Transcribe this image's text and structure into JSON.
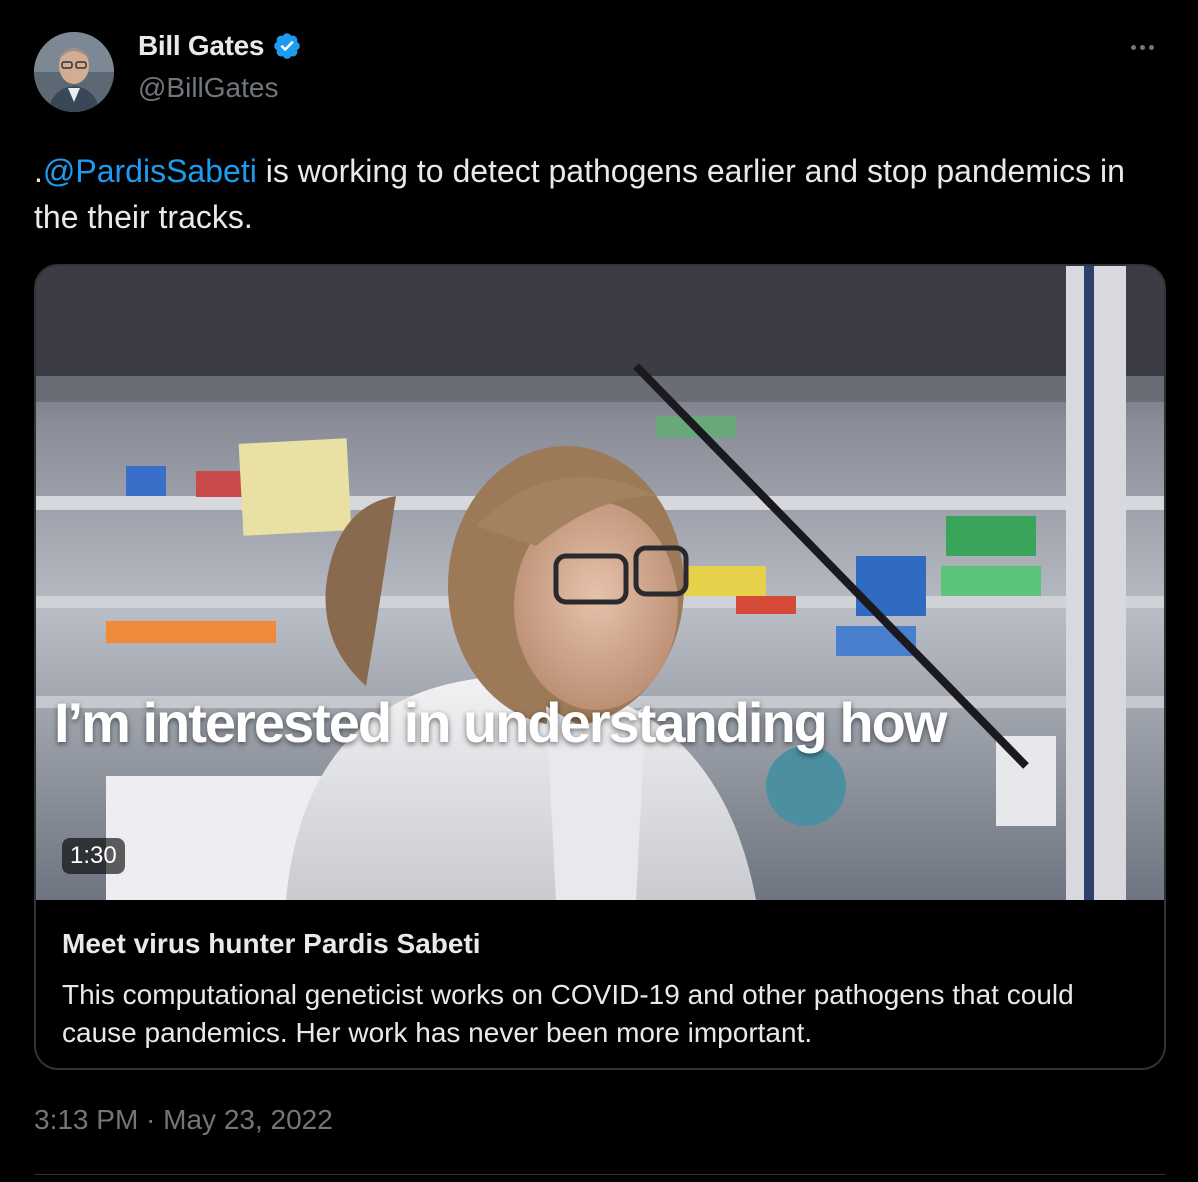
{
  "author": {
    "name": "Bill Gates",
    "handle": "@BillGates",
    "verified_icon": "verified-badge-icon"
  },
  "more_icon": "more-options-icon",
  "tweet": {
    "prefix": ".",
    "mention": "@PardisSabeti",
    "text_after_mention": " is working to detect pathogens earlier and stop pandemics in the their tracks."
  },
  "card": {
    "video_caption": "I’m interested in understanding how",
    "duration": "1:30",
    "title": "Meet virus hunter Pardis Sabeti",
    "description": "This computational geneticist works on COVID-19 and other pathogens that could cause pandemics. Her work has never been more important."
  },
  "timestamp": "3:13 PM · May 23, 2022",
  "colors": {
    "background": "#000000",
    "text": "#e7e9ea",
    "secondary": "#71767b",
    "link": "#1d9bf0",
    "border": "#2f3336"
  }
}
